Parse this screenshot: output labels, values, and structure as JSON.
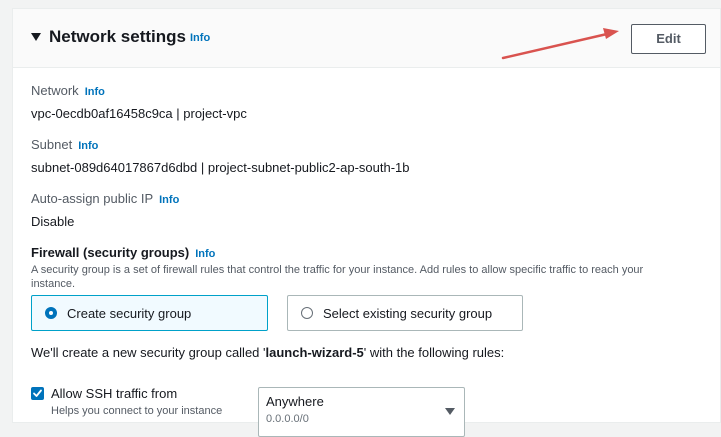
{
  "header": {
    "title": "Network settings",
    "info": "Info",
    "edit_label": "Edit"
  },
  "network": {
    "label": "Network",
    "info": "Info",
    "value": "vpc-0ecdb0af16458c9ca | project-vpc"
  },
  "subnet": {
    "label": "Subnet",
    "info": "Info",
    "value": "subnet-089d64017867d6dbd | project-subnet-public2-ap-south-1b"
  },
  "public_ip": {
    "label": "Auto-assign public IP",
    "info": "Info",
    "value": "Disable"
  },
  "firewall": {
    "label": "Firewall (security groups)",
    "info": "Info",
    "description": "A security group is a set of firewall rules that control the traffic for your instance. Add rules to allow specific traffic to reach your instance.",
    "options": [
      {
        "label": "Create security group",
        "selected": true
      },
      {
        "label": "Select existing security group",
        "selected": false
      }
    ],
    "note_prefix": "We'll create a new security group called '",
    "note_name": "launch-wizard-5",
    "note_suffix": "' with the following rules:"
  },
  "ssh_rule": {
    "checked": true,
    "label": "Allow SSH traffic from",
    "help": "Helps you connect to your instance",
    "source_value": "Anywhere",
    "source_sub": "0.0.0.0/0"
  },
  "icons": {
    "caret": "caret-down-icon",
    "arrow": "annotation-arrow-icon",
    "dropdown": "chevron-down-icon",
    "check": "checkmark-icon"
  },
  "colors": {
    "link": "#0073bb",
    "annotation_arrow": "#d9534f",
    "selected_border": "#00a1c9"
  }
}
